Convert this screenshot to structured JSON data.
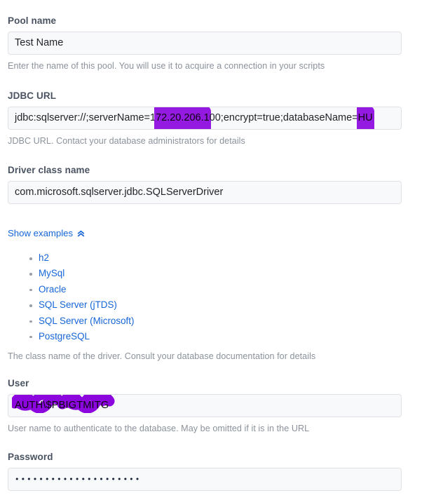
{
  "form": {
    "pool_name": {
      "label": "Pool name",
      "value": "Test Name",
      "help": "Enter the name of this pool. You will use it to acquire a connection in your scripts"
    },
    "jdbc_url": {
      "label": "JDBC URL",
      "prefix": "jdbc:sqlserver://;serverName=1",
      "redacted_1": "72.20.206.1",
      "middle": "00;encrypt=true;databaseName=",
      "redacted_2": "HU",
      "help": "JDBC URL. Contact your database administrators for details"
    },
    "driver_class": {
      "label": "Driver class name",
      "value": "com.microsoft.sqlserver.jdbc.SQLServerDriver",
      "help": "The class name of the driver. Consult your database documentation for details"
    },
    "show_examples": {
      "label": "Show examples",
      "icon": "chevron-double-up-icon",
      "expanded": true
    },
    "examples": [
      {
        "label": "h2"
      },
      {
        "label": "MySql"
      },
      {
        "label": "Oracle"
      },
      {
        "label": "SQL Server (jTDS)"
      },
      {
        "label": "SQL Server (Microsoft)"
      },
      {
        "label": "PostgreSQL"
      }
    ],
    "user": {
      "label": "User",
      "value": "AUTH\\$PBIGTMITG",
      "redacted": true,
      "help": "User name to authenticate to the database. May be omitted if it is in the URL"
    },
    "password": {
      "label": "Password",
      "masked_value": "•••••••••••••••••••••",
      "dot_count": 21
    }
  },
  "colors": {
    "label": "#4a5361",
    "help_text": "#8b929c",
    "link": "#1565d8",
    "input_bg": "#f8f9fa",
    "input_border": "#dfe1e5",
    "redaction": "#8c07de",
    "page_bg": "#ffffff"
  }
}
